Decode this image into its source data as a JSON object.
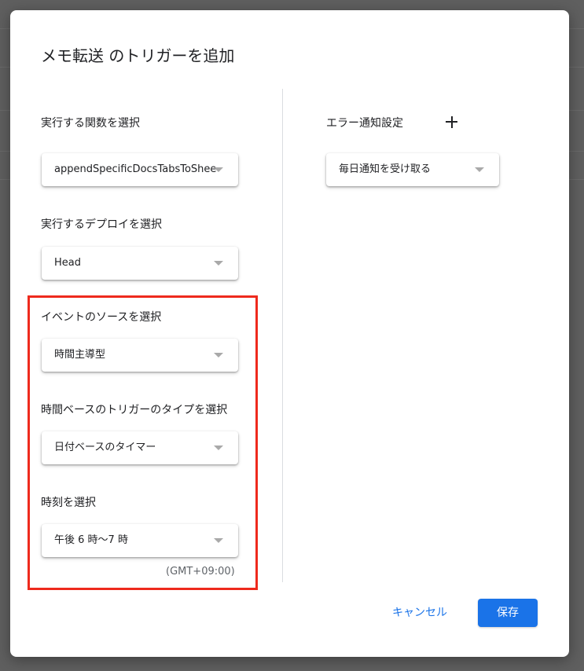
{
  "dialog": {
    "title": "メモ転送 のトリガーを追加"
  },
  "left": {
    "function": {
      "label": "実行する関数を選択",
      "value": "appendSpecificDocsTabsToSheet"
    },
    "deployment": {
      "label": "実行するデプロイを選択",
      "value": "Head"
    },
    "event_source": {
      "label": "イベントのソースを選択",
      "value": "時間主導型"
    },
    "time_trigger_type": {
      "label": "時間ベースのトリガーのタイプを選択",
      "value": "日付ベースのタイマー"
    },
    "time_of_day": {
      "label": "時刻を選択",
      "value": "午後 6 時〜7 時",
      "timezone": "(GMT+09:00)"
    }
  },
  "right": {
    "error_notification": {
      "label": "エラー通知設定",
      "value": "毎日通知を受け取る"
    }
  },
  "actions": {
    "cancel": "キャンセル",
    "save": "保存"
  },
  "colors": {
    "primary": "#1a73e8",
    "highlight": "#ee2a1d"
  },
  "icons": {
    "add": "plus-icon",
    "dropdown": "caret-down-icon"
  }
}
